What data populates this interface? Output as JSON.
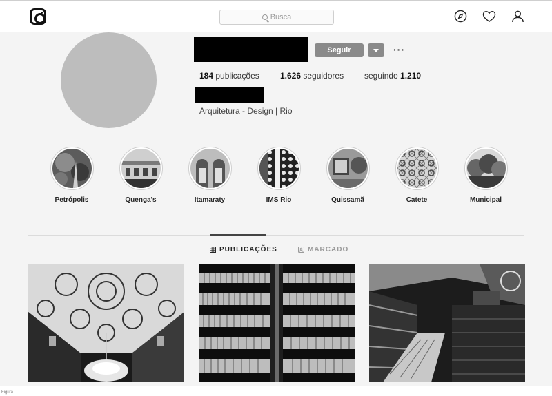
{
  "search": {
    "placeholder": "Busca"
  },
  "profile": {
    "follow_label": "Seguir",
    "more_label": "···",
    "stats": [
      {
        "count": "184",
        "label": " publicações"
      },
      {
        "count": "1.626",
        "label": " seguidores"
      },
      {
        "label": "seguindo ",
        "count": "1.210"
      }
    ],
    "bio": "Arquitetura - Design | Rio"
  },
  "highlights": [
    {
      "label": "Petrópolis"
    },
    {
      "label": "Quenga's"
    },
    {
      "label": "Itamaraty"
    },
    {
      "label": "IMS Rio"
    },
    {
      "label": "Quissamã"
    },
    {
      "label": "Catete"
    },
    {
      "label": "Municipal"
    }
  ],
  "tabs": [
    {
      "label": "PUBLICAÇÕES",
      "active": true
    },
    {
      "label": "MARCADO",
      "active": false
    }
  ],
  "caption": "Figura"
}
